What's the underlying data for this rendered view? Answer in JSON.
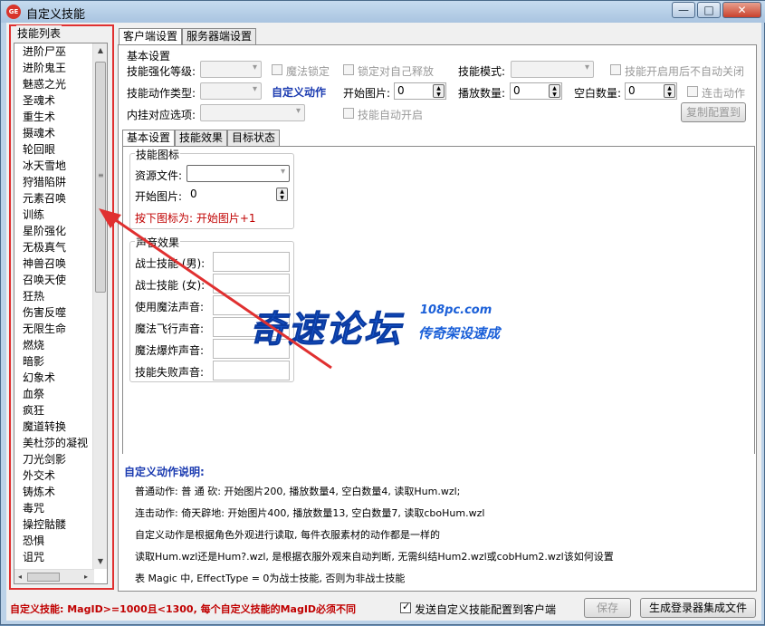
{
  "window": {
    "title": "自定义技能",
    "minimize": "—",
    "maximize": "□",
    "close": "✕"
  },
  "skill_list": {
    "title": "技能列表",
    "items": [
      "进阶尸巫",
      "进阶鬼王",
      "魅惑之光",
      "圣魂术",
      "重生术",
      "摄魂术",
      "轮回眼",
      "冰天雪地",
      "狩猎陷阱",
      "元素召唤",
      "训练",
      "星阶强化",
      "无极真气",
      "神兽召唤",
      "召唤天使",
      "狂热",
      "伤害反噬",
      "无限生命",
      "燃烧",
      "暗影",
      "幻象术",
      "血祭",
      "疯狂",
      "魔道转换",
      "美杜莎的凝视",
      "刀光剑影",
      "外交术",
      "铸炼术",
      "毒咒",
      "操控骷髅",
      "恐惧",
      "诅咒"
    ]
  },
  "main_tabs": [
    "客户端设置",
    "服务器端设置"
  ],
  "basic": {
    "title": "基本设置",
    "skill_level_label": "技能强化等级:",
    "magic_lock": "魔法锁定",
    "lock_self_cast": "锁定对自己释放",
    "skill_mode_label": "技能模式:",
    "no_auto_close": "技能开启用后不自动关闭",
    "action_type_label": "技能动作类型:",
    "custom_action": "自定义动作",
    "start_frame_label": "开始图片:",
    "start_frame_value": "0",
    "play_count_label": "播放数量:",
    "play_count_value": "0",
    "blank_count_label": "空白数量:",
    "blank_count_value": "0",
    "combo_action": "连击动作",
    "hook_label": "内挂对应选项:",
    "auto_enable": "技能自动开启",
    "copy_config": "复制配置到"
  },
  "sub_tabs": [
    "基本设置",
    "技能效果",
    "目标状态"
  ],
  "icon_group": {
    "title": "技能图标",
    "resource_label": "资源文件:",
    "start_label": "开始图片:",
    "start_value": "0",
    "hint": "按下图标为: 开始图片+1"
  },
  "sound_group": {
    "title": "声音效果",
    "rows": [
      "战士技能 (男):",
      "战士技能 (女):",
      "使用魔法声音:",
      "魔法飞行声音:",
      "魔法爆炸声音:",
      "技能失败声音:"
    ]
  },
  "watermark": {
    "main": "奇速论坛",
    "url": "108pc.com",
    "sub": "传奇架设速成"
  },
  "notes": {
    "title": "自定义动作说明:",
    "lines": [
      "普通动作: 普 通 砍: 开始图片200, 播放数量4, 空白数量4, 读取Hum.wzl;",
      "连击动作: 倚天辟地: 开始图片400, 播放数量13, 空白数量7, 读取cboHum.wzl",
      "自定义动作是根据角色外观进行读取, 每件衣服素材的动作都是一样的",
      "读取Hum.wzl还是Hum?.wzl, 是根据衣服外观来自动判断, 无需纠结Hum2.wzl或cobHum2.wzl该如何设置",
      "表 Magic 中, EffectType = 0为战士技能, 否则为非战士技能"
    ]
  },
  "footer": {
    "warning": "自定义技能: MagID>=1000且<1300, 每个自定义技能的MagID必须不同",
    "send_config": "发送自定义技能配置到客户端",
    "save": "保存",
    "generate": "生成登录器集成文件"
  },
  "colors": {
    "accent_blue": "#1a3ab0",
    "warning_red": "#c00000",
    "highlight_border": "#e03030"
  }
}
